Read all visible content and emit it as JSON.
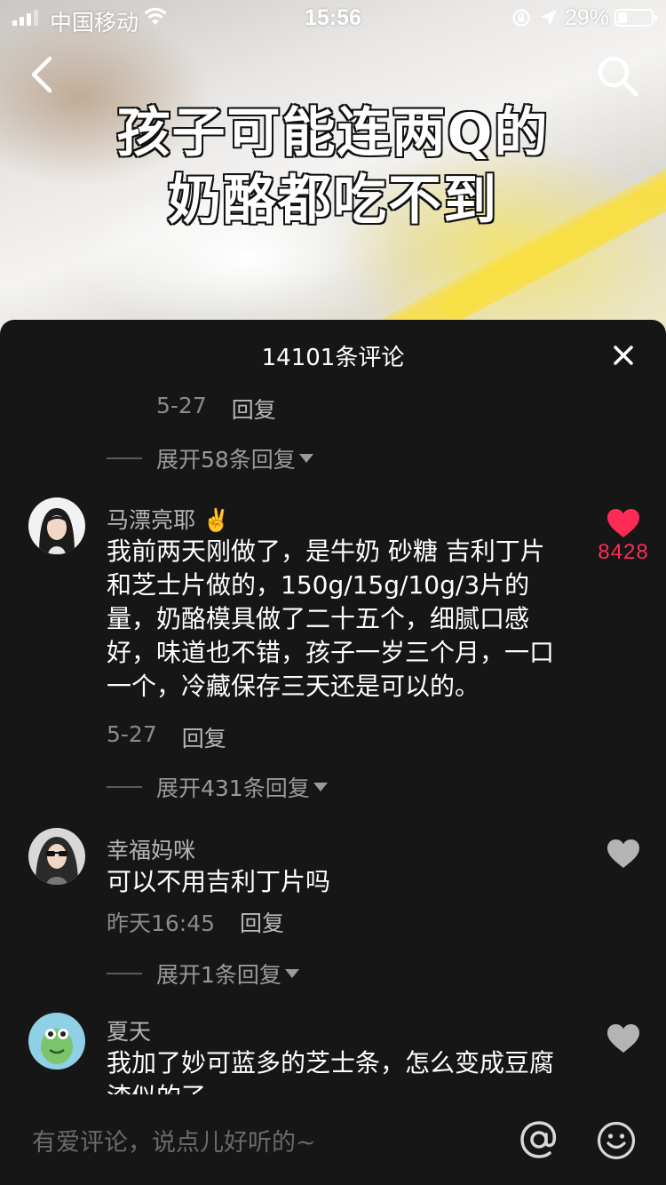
{
  "status_bar": {
    "carrier": "中国移动",
    "time": "15:56",
    "battery_percent": "29%",
    "battery_level": 0.29
  },
  "video": {
    "title_line1": "孩子可能连两Q的",
    "title_line2": "奶酪都吃不到"
  },
  "sheet": {
    "title": "14101条评论",
    "close_icon": "close-icon"
  },
  "comments": [
    {
      "date": "5-27",
      "reply_label": "回复",
      "expand_label": "展开58条回复"
    },
    {
      "username": "马漂亮耶 ✌️",
      "text": "我前两天刚做了，是牛奶 砂糖 吉利丁片和芝士片做的，150g/15g/10g/3片的量，奶酪模具做了二十五个，细腻口感好，味道也不错，孩子一岁三个月，一口一个，冷藏保存三天还是可以的。",
      "date": "5-27",
      "reply_label": "回复",
      "like_count": "8428",
      "liked": true,
      "expand_label": "展开431条回复"
    },
    {
      "username": "幸福妈咪",
      "text": "可以不用吉利丁片吗",
      "date": "昨天16:45",
      "reply_label": "回复",
      "liked": false,
      "expand_label": "展开1条回复"
    },
    {
      "username": "夏天",
      "text": "我加了妙可蓝多的芝士条，怎么变成豆腐渣似的了",
      "liked": false
    }
  ],
  "input_bar": {
    "placeholder": "有爱评论，说点儿好听的~",
    "at_icon": "at-icon",
    "emoji_icon": "emoji-icon"
  },
  "colors": {
    "sheet_bg": "#161616",
    "like_active": "#fe2c55",
    "like_inactive": "#dcdcdc",
    "meta_text": "#8a8a8a"
  }
}
